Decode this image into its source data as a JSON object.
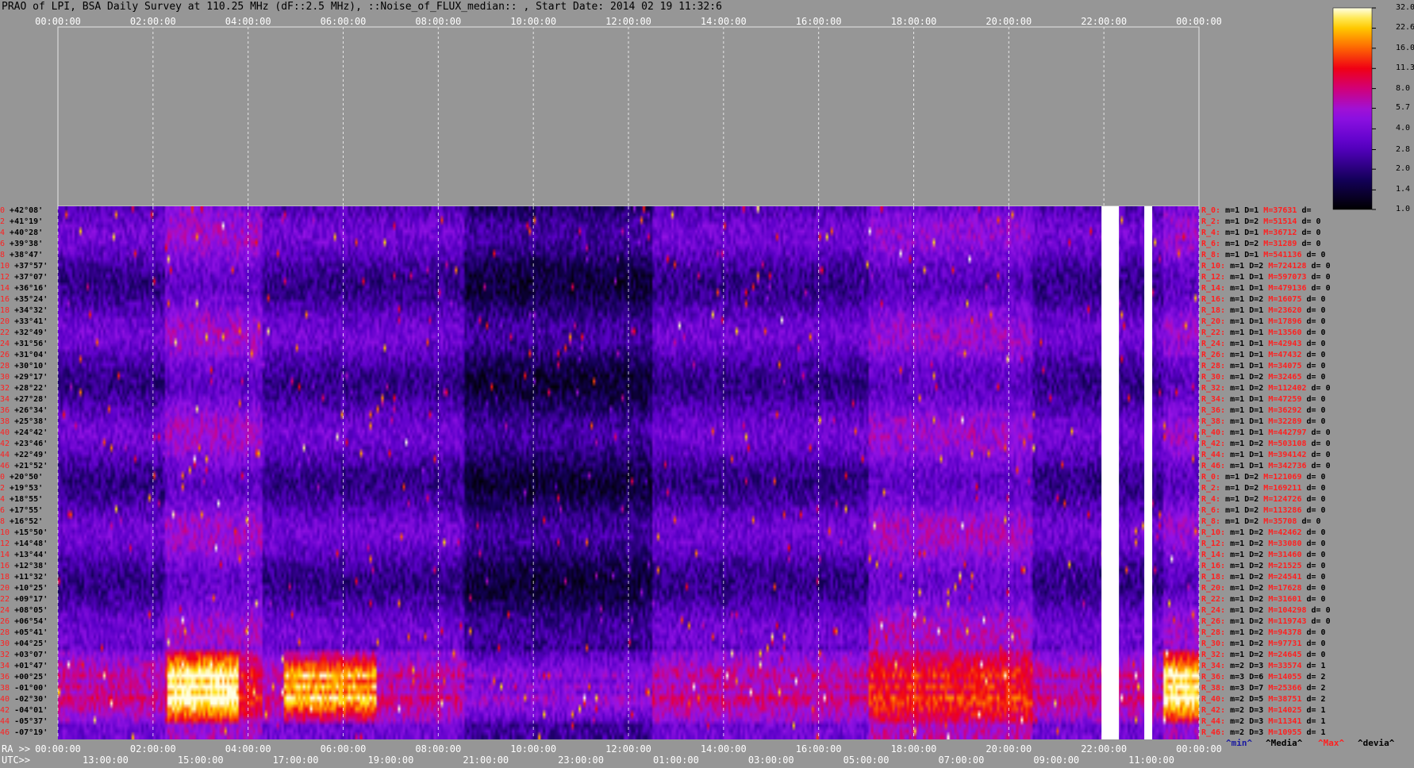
{
  "title": "PRAO of LPI, BSA Daily Survey at 110.25 MHz (dF::2.5 MHz), ::Noise_of_FLUX_median:: , Start Date: 2014 02 19 11:32:6",
  "chart_data": {
    "type": "heatmap",
    "title": "PRAO of LPI, BSA Daily Survey at 110.25 MHz (dF::2.5 MHz), ::Noise_of_FLUX_median:: , Start Date: 2014 02 19 11:32:6",
    "top_axis_ticks": [
      "00:00:00",
      "02:00:00",
      "04:00:00",
      "06:00:00",
      "08:00:00",
      "10:00:00",
      "12:00:00",
      "14:00:00",
      "16:00:00",
      "18:00:00",
      "20:00:00",
      "22:00:00",
      "00:00:00"
    ],
    "ra_axis_label": "RA >>",
    "ra_axis_ticks": [
      "00:00:00",
      "02:00:00",
      "04:00:00",
      "06:00:00",
      "08:00:00",
      "10:00:00",
      "12:00:00",
      "14:00:00",
      "16:00:00",
      "18:00:00",
      "20:00:00",
      "22:00:00",
      "00:00:00"
    ],
    "utc_axis_label": "UTC>>",
    "utc_axis_ticks": [
      "13:00:00",
      "15:00:00",
      "17:00:00",
      "19:00:00",
      "21:00:00",
      "23:00:00",
      "01:00:00",
      "03:00:00",
      "05:00:00",
      "07:00:00",
      "09:00:00",
      "11:00:00"
    ],
    "colorbar_ticks": [
      "32.0",
      "22.6",
      "16.0",
      "11.3",
      "8.0",
      "5.7",
      "4.0",
      "2.8",
      "2.0",
      "1.4",
      "1.0"
    ],
    "colorbar_range": [
      1.0,
      32.0
    ],
    "colorbar_scale": "log",
    "rows": [
      {
        "i": "0",
        "dec": "+42°08'"
      },
      {
        "i": "2",
        "dec": "+41°19'"
      },
      {
        "i": "4",
        "dec": "+40°28'"
      },
      {
        "i": "6",
        "dec": "+39°38'"
      },
      {
        "i": "8",
        "dec": "+38°47'"
      },
      {
        "i": "10",
        "dec": "+37°57'"
      },
      {
        "i": "12",
        "dec": "+37°07'"
      },
      {
        "i": "14",
        "dec": "+36°16'"
      },
      {
        "i": "16",
        "dec": "+35°24'"
      },
      {
        "i": "18",
        "dec": "+34°32'"
      },
      {
        "i": "20",
        "dec": "+33°41'"
      },
      {
        "i": "22",
        "dec": "+32°49'"
      },
      {
        "i": "24",
        "dec": "+31°56'"
      },
      {
        "i": "26",
        "dec": "+31°04'"
      },
      {
        "i": "28",
        "dec": "+30°10'"
      },
      {
        "i": "30",
        "dec": "+29°17'"
      },
      {
        "i": "32",
        "dec": "+28°22'"
      },
      {
        "i": "34",
        "dec": "+27°28'"
      },
      {
        "i": "36",
        "dec": "+26°34'"
      },
      {
        "i": "38",
        "dec": "+25°38'"
      },
      {
        "i": "40",
        "dec": "+24°42'"
      },
      {
        "i": "42",
        "dec": "+23°46'"
      },
      {
        "i": "44",
        "dec": "+22°49'"
      },
      {
        "i": "46",
        "dec": "+21°52'"
      },
      {
        "i": "0",
        "dec": "+20°50'"
      },
      {
        "i": "2",
        "dec": "+19°53'"
      },
      {
        "i": "4",
        "dec": "+18°55'"
      },
      {
        "i": "6",
        "dec": "+17°55'"
      },
      {
        "i": "8",
        "dec": "+16°52'"
      },
      {
        "i": "10",
        "dec": "+15°50'"
      },
      {
        "i": "12",
        "dec": "+14°48'"
      },
      {
        "i": "14",
        "dec": "+13°44'"
      },
      {
        "i": "16",
        "dec": "+12°38'"
      },
      {
        "i": "18",
        "dec": "+11°32'"
      },
      {
        "i": "20",
        "dec": "+10°25'"
      },
      {
        "i": "22",
        "dec": "+09°17'"
      },
      {
        "i": "24",
        "dec": "+08°05'"
      },
      {
        "i": "26",
        "dec": "+06°54'"
      },
      {
        "i": "28",
        "dec": "+05°41'"
      },
      {
        "i": "30",
        "dec": "+04°25'"
      },
      {
        "i": "32",
        "dec": "+03°07'"
      },
      {
        "i": "34",
        "dec": "+01°47'"
      },
      {
        "i": "36",
        "dec": "+00°25'"
      },
      {
        "i": "38",
        "dec": "-01°00'"
      },
      {
        "i": "40",
        "dec": "-02°30'"
      },
      {
        "i": "42",
        "dec": "-04°01'"
      },
      {
        "i": "44",
        "dec": "-05°37'"
      },
      {
        "i": "46",
        "dec": "-07°19'"
      }
    ],
    "stats": [
      {
        "r": "R_0:",
        "m": "m=1",
        "D": "D=1",
        "M": "M=37631",
        "d": "d="
      },
      {
        "r": "R_2:",
        "m": "m=1",
        "D": "D=2",
        "M": "M=51514",
        "d": "d= 0"
      },
      {
        "r": "R_4:",
        "m": "m=1",
        "D": "D=1",
        "M": "M=36712",
        "d": "d= 0"
      },
      {
        "r": "R_6:",
        "m": "m=1",
        "D": "D=2",
        "M": "M=31289",
        "d": "d= 0"
      },
      {
        "r": "R_8:",
        "m": "m=1",
        "D": "D=1",
        "M": "M=541136",
        "d": "d= 0"
      },
      {
        "r": "R_10:",
        "m": "m=1",
        "D": "D=2",
        "M": "M=724128",
        "d": "d= 0"
      },
      {
        "r": "R_12:",
        "m": "m=1",
        "D": "D=1",
        "M": "M=597073",
        "d": "d= 0"
      },
      {
        "r": "R_14:",
        "m": "m=1",
        "D": "D=1",
        "M": "M=479136",
        "d": "d= 0"
      },
      {
        "r": "R_16:",
        "m": "m=1",
        "D": "D=2",
        "M": "M=16075",
        "d": "d= 0"
      },
      {
        "r": "R_18:",
        "m": "m=1",
        "D": "D=1",
        "M": "M=23620",
        "d": "d= 0"
      },
      {
        "r": "R_20:",
        "m": "m=1",
        "D": "D=1",
        "M": "M=17896",
        "d": "d= 0"
      },
      {
        "r": "R_22:",
        "m": "m=1",
        "D": "D=1",
        "M": "M=13560",
        "d": "d= 0"
      },
      {
        "r": "R_24:",
        "m": "m=1",
        "D": "D=1",
        "M": "M=42943",
        "d": "d= 0"
      },
      {
        "r": "R_26:",
        "m": "m=1",
        "D": "D=1",
        "M": "M=47432",
        "d": "d= 0"
      },
      {
        "r": "R_28:",
        "m": "m=1",
        "D": "D=1",
        "M": "M=34075",
        "d": "d= 0"
      },
      {
        "r": "R_30:",
        "m": "m=1",
        "D": "D=2",
        "M": "M=32465",
        "d": "d= 0"
      },
      {
        "r": "R_32:",
        "m": "m=1",
        "D": "D=2",
        "M": "M=112402",
        "d": "d= 0"
      },
      {
        "r": "R_34:",
        "m": "m=1",
        "D": "D=1",
        "M": "M=47259",
        "d": "d= 0"
      },
      {
        "r": "R_36:",
        "m": "m=1",
        "D": "D=1",
        "M": "M=36292",
        "d": "d= 0"
      },
      {
        "r": "R_38:",
        "m": "m=1",
        "D": "D=1",
        "M": "M=32289",
        "d": "d= 0"
      },
      {
        "r": "R_40:",
        "m": "m=1",
        "D": "D=1",
        "M": "M=442797",
        "d": "d= 0"
      },
      {
        "r": "R_42:",
        "m": "m=1",
        "D": "D=2",
        "M": "M=503108",
        "d": "d= 0"
      },
      {
        "r": "R_44:",
        "m": "m=1",
        "D": "D=1",
        "M": "M=394142",
        "d": "d= 0"
      },
      {
        "r": "R_46:",
        "m": "m=1",
        "D": "D=1",
        "M": "M=342736",
        "d": "d= 0"
      },
      {
        "r": "R_0:",
        "m": "m=1",
        "D": "D=2",
        "M": "M=121069",
        "d": "d= 0"
      },
      {
        "r": "R_2:",
        "m": "m=1",
        "D": "D=2",
        "M": "M=169211",
        "d": "d= 0"
      },
      {
        "r": "R_4:",
        "m": "m=1",
        "D": "D=2",
        "M": "M=124726",
        "d": "d= 0"
      },
      {
        "r": "R_6:",
        "m": "m=1",
        "D": "D=2",
        "M": "M=113286",
        "d": "d= 0"
      },
      {
        "r": "R_8:",
        "m": "m=1",
        "D": "D=2",
        "M": "M=35708",
        "d": "d= 0"
      },
      {
        "r": "R_10:",
        "m": "m=1",
        "D": "D=2",
        "M": "M=42462",
        "d": "d= 0"
      },
      {
        "r": "R_12:",
        "m": "m=1",
        "D": "D=2",
        "M": "M=33080",
        "d": "d= 0"
      },
      {
        "r": "R_14:",
        "m": "m=1",
        "D": "D=2",
        "M": "M=31460",
        "d": "d= 0"
      },
      {
        "r": "R_16:",
        "m": "m=1",
        "D": "D=2",
        "M": "M=21525",
        "d": "d= 0"
      },
      {
        "r": "R_18:",
        "m": "m=1",
        "D": "D=2",
        "M": "M=24541",
        "d": "d= 0"
      },
      {
        "r": "R_20:",
        "m": "m=1",
        "D": "D=2",
        "M": "M=17628",
        "d": "d= 0"
      },
      {
        "r": "R_22:",
        "m": "m=1",
        "D": "D=2",
        "M": "M=31601",
        "d": "d= 0"
      },
      {
        "r": "R_24:",
        "m": "m=1",
        "D": "D=2",
        "M": "M=104298",
        "d": "d= 0"
      },
      {
        "r": "R_26:",
        "m": "m=1",
        "D": "D=2",
        "M": "M=119743",
        "d": "d= 0"
      },
      {
        "r": "R_28:",
        "m": "m=1",
        "D": "D=2",
        "M": "M=94378",
        "d": "d= 0"
      },
      {
        "r": "R_30:",
        "m": "m=1",
        "D": "D=2",
        "M": "M=97731",
        "d": "d= 0"
      },
      {
        "r": "R_32:",
        "m": "m=1",
        "D": "D=2",
        "M": "M=24645",
        "d": "d= 0"
      },
      {
        "r": "R_34:",
        "m": "m=2",
        "D": "D=3",
        "M": "M=33574",
        "d": "d= 1"
      },
      {
        "r": "R_36:",
        "m": "m=3",
        "D": "D=6",
        "M": "M=14055",
        "d": "d= 2"
      },
      {
        "r": "R_38:",
        "m": "m=3",
        "D": "D=7",
        "M": "M=25366",
        "d": "d= 2"
      },
      {
        "r": "R_40:",
        "m": "m=2",
        "D": "D=5",
        "M": "M=38751",
        "d": "d= 2"
      },
      {
        "r": "R_42:",
        "m": "m=2",
        "D": "D=3",
        "M": "M=14025",
        "d": "d= 1"
      },
      {
        "r": "R_44:",
        "m": "m=2",
        "D": "D=3",
        "M": "M=11341",
        "d": "d= 1"
      },
      {
        "r": "R_46:",
        "m": "m=2",
        "D": "D=3",
        "M": "M=10955",
        "d": "d= 1"
      }
    ],
    "legend": [
      {
        "text": "^min^",
        "color": "#1a1aa0"
      },
      {
        "text": "^Media^",
        "color": "#000000"
      },
      {
        "text": "^Max^",
        "color": "#ff2020"
      },
      {
        "text": "^devia^",
        "color": "#000000"
      }
    ],
    "features": {
      "bright_rows": [
        "+00°25'",
        "-01°00'",
        "-02°30'"
      ],
      "saturated_columns_hours": [
        21.95,
        22.15,
        22.85
      ],
      "dashed_grid_hours": [
        0,
        2,
        4,
        6,
        8,
        10,
        12,
        14,
        16,
        18,
        20,
        22,
        24
      ]
    }
  }
}
